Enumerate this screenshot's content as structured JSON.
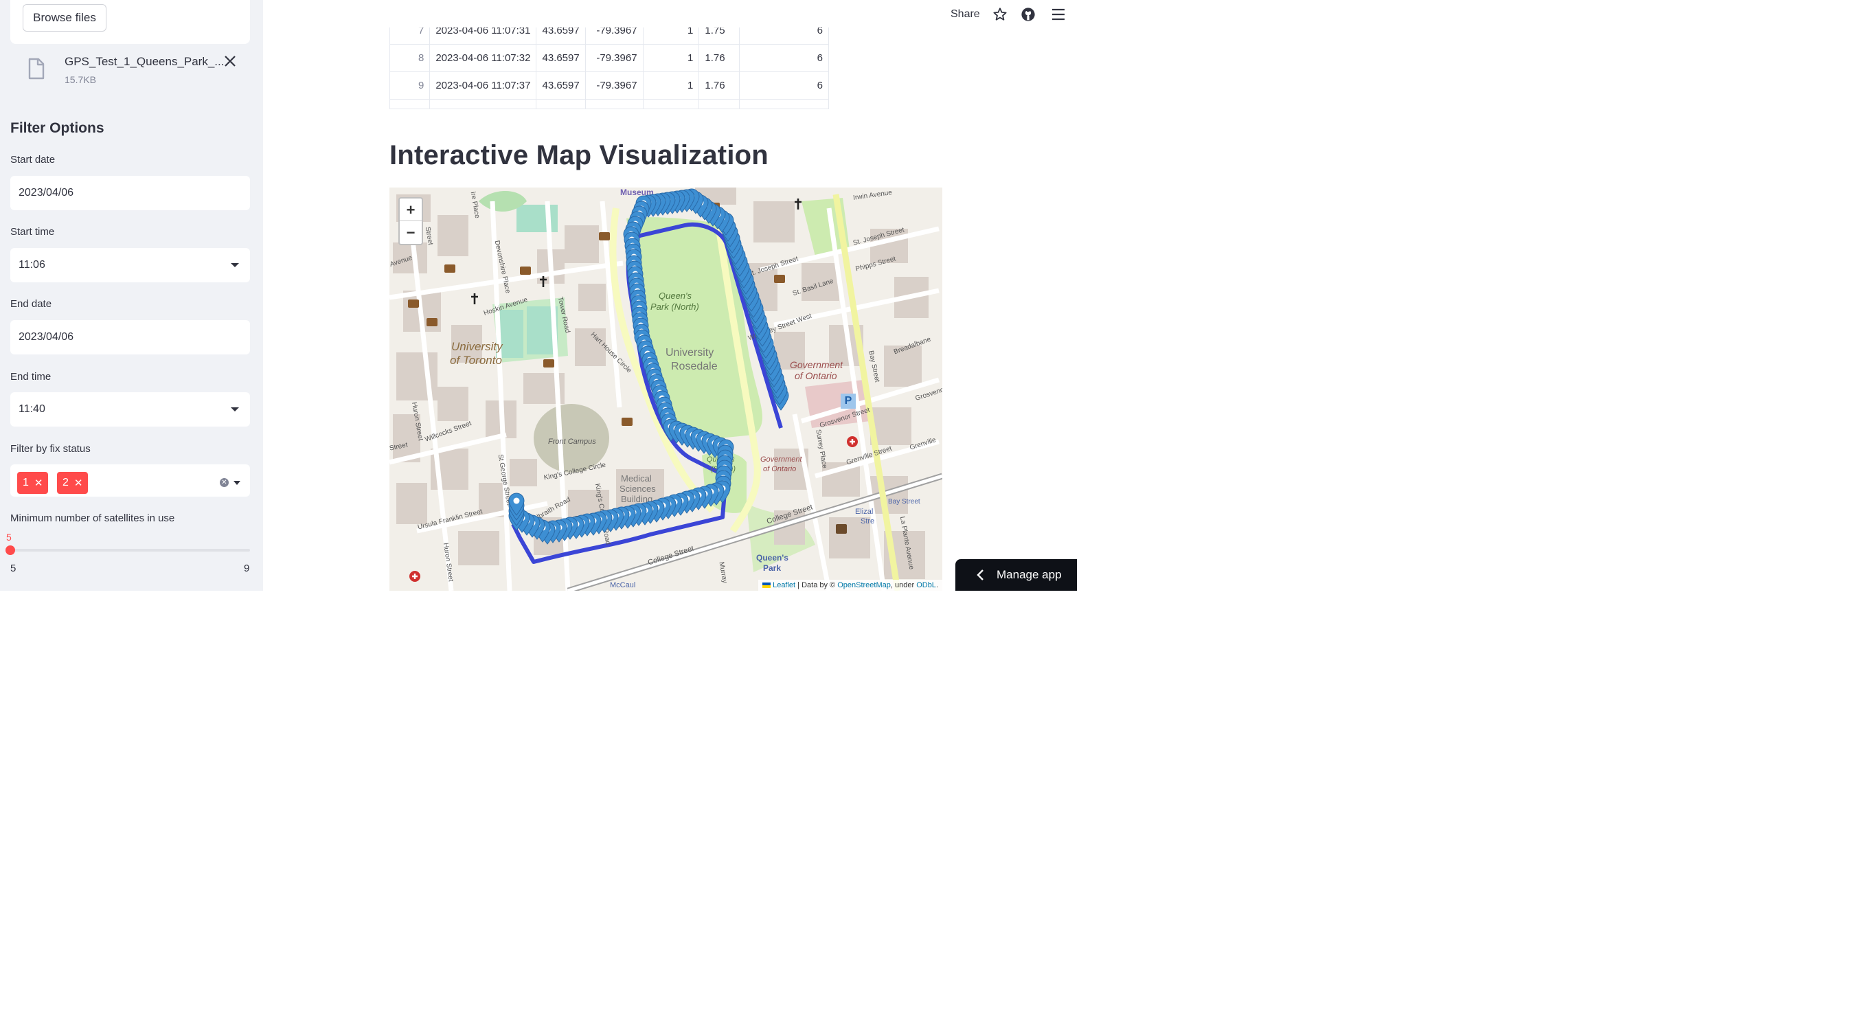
{
  "sidebar": {
    "browse_label": "Browse files",
    "file": {
      "name": "GPS_Test_1_Queens_Park_...",
      "size": "15.7KB"
    },
    "heading": "Filter Options",
    "start_date": {
      "label": "Start date",
      "value": "2023/04/06"
    },
    "start_time": {
      "label": "Start time",
      "value": "11:06"
    },
    "end_date": {
      "label": "End date",
      "value": "2023/04/06"
    },
    "end_time": {
      "label": "End time",
      "value": "11:40"
    },
    "fix_status": {
      "label": "Filter by fix status",
      "tags": [
        "1",
        "2"
      ]
    },
    "satellites": {
      "label": "Minimum number of satellites in use",
      "value": "5",
      "min": "5",
      "max": "9"
    }
  },
  "header": {
    "share": "Share"
  },
  "table": {
    "rows": [
      {
        "idx": "7",
        "timestamp": "2023-04-06 11:07:31",
        "lat": "43.6597",
        "lon": "-79.3967",
        "fix": "1",
        "hdop": "1.75",
        "sats": "6"
      },
      {
        "idx": "8",
        "timestamp": "2023-04-06 11:07:32",
        "lat": "43.6597",
        "lon": "-79.3967",
        "fix": "1",
        "hdop": "1.76",
        "sats": "6"
      },
      {
        "idx": "9",
        "timestamp": "2023-04-06 11:07:37",
        "lat": "43.6597",
        "lon": "-79.3967",
        "fix": "1",
        "hdop": "1.76",
        "sats": "6"
      }
    ]
  },
  "main": {
    "title": "Interactive Map Visualization"
  },
  "map": {
    "zoom_in": "+",
    "zoom_out": "−",
    "attribution": {
      "leaflet": "Leaflet",
      "data_by": " | Data by © ",
      "osm": "OpenStreetMap",
      "under": ", under ",
      "odbl": "ODbL",
      "end": "."
    },
    "labels": {
      "museum": "Museum",
      "irwin": "Irwin Avenue",
      "stjoseph": "St. Joseph Street",
      "stjoseph2": "St. Joseph Street",
      "phipps": "Phipps Street",
      "stbasil": "St. Basil Lane",
      "wellesley": "Wellesley Street West",
      "breadalbane": "Breadalbane",
      "grosvenor": "Grosvenor Street",
      "grosvenor2": "Grosvenor",
      "grenville": "Grenville Street",
      "grenville2": "Grenville",
      "bay": "Bay Street",
      "bay2": "Bay Street",
      "hoskin": "Hoskin Avenue",
      "devonshire": "Devonshire Place",
      "tower": "Tower Road",
      "harthouse": "Hart House Circle",
      "uoft1": "University",
      "uoft2": "of Toronto",
      "qpnorth1": "Queen's",
      "qpnorth2": "Park (North)",
      "rosedale1": "University",
      "rosedale2": "Rosedale",
      "gov1": "Government",
      "gov2": "of Ontario",
      "govs1": "Government",
      "govs2": "of Ontario",
      "qpsouth1": "Queen's",
      "qpsouth2": "(South)",
      "frontcampus": "Front Campus",
      "kingscollege": "King's College Circle",
      "medsci1": "Medical",
      "medsci2": "Sciences",
      "medsci3": "Building",
      "willcocks": "Willcocks Street",
      "huron": "Huron Street",
      "huron2": "Huron Street",
      "stgeorge": "St George Street",
      "galbraith": "Galbraith Road",
      "kcroad": "King's College Road",
      "ursula": "Ursula Franklin Street",
      "college": "College Street",
      "college2": "College Street",
      "queenspark1": "Queen's",
      "queenspark2": "Park",
      "mccaul": "McCaul",
      "surrey": "Surrey Place",
      "laplante": "La Plante Avenue",
      "elizabeth": "Elizal",
      "elizabeth2": "Stre",
      "murray": "Murray",
      "avenue": "Avenue",
      "street": "Street",
      "stgeorge_top": "ire Place",
      "street2": "Street"
    }
  },
  "manage": {
    "label": "Manage app"
  }
}
